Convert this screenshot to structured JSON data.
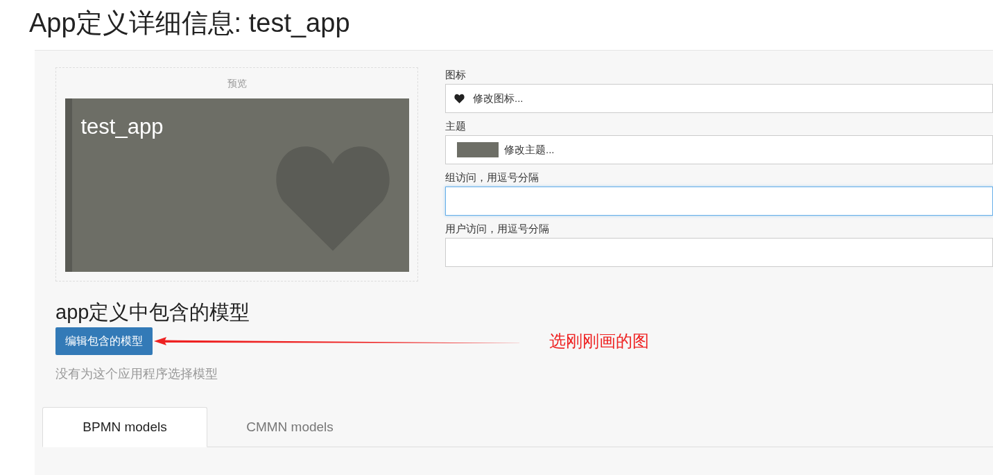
{
  "page_title": "App定义详细信息: test_app",
  "preview": {
    "label": "预览",
    "app_name": "test_app"
  },
  "fields": [
    {
      "label": "图标",
      "kind": "icon",
      "text": "修改图标...",
      "focused": false
    },
    {
      "label": "主题",
      "kind": "theme",
      "text": "修改主题...",
      "focused": false
    },
    {
      "label": "组访问，用逗号分隔",
      "kind": "text",
      "focused": true
    },
    {
      "label": "用户访问，用逗号分隔",
      "kind": "text",
      "focused": false
    }
  ],
  "models_heading": "app定义中包含的模型",
  "edit_button": "编辑包含的模型",
  "annotation": "选刚刚画的图",
  "empty_text": "没有为这个应用程序选择模型",
  "tabs": [
    {
      "label": "BPMN models",
      "selected": true
    },
    {
      "label": "CMMN models",
      "selected": false
    }
  ]
}
